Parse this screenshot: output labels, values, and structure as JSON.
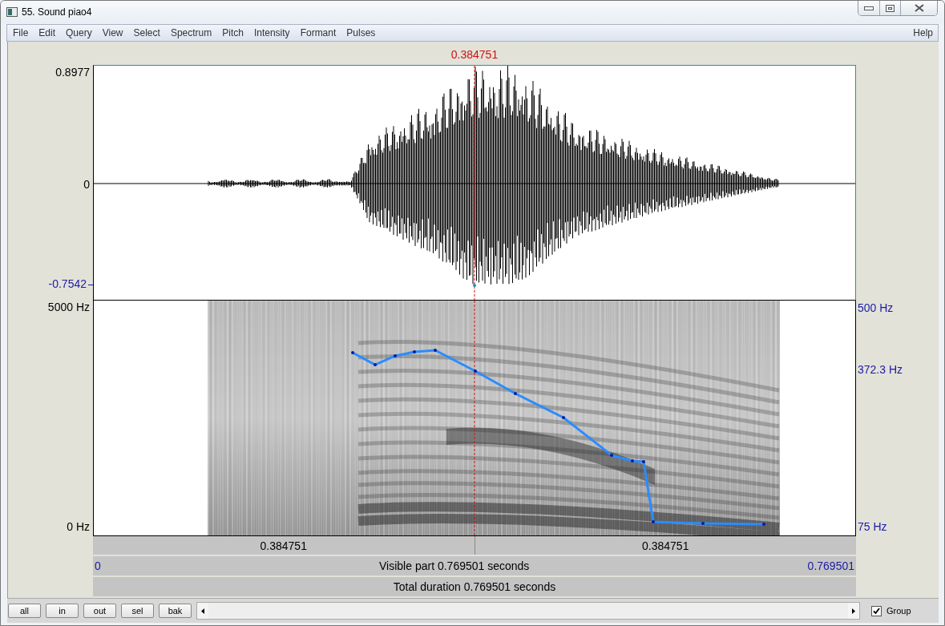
{
  "window": {
    "title": "55. Sound piao4"
  },
  "menu": {
    "items": [
      "File",
      "Edit",
      "Query",
      "View",
      "Select",
      "Spectrum",
      "Pitch",
      "Intensity",
      "Formant",
      "Pulses"
    ],
    "help": "Help"
  },
  "cursor": {
    "time": "0.384751"
  },
  "waveform": {
    "max_label": "0.8977",
    "zero_label": "0",
    "min_label": "-0.7542"
  },
  "spectrogram": {
    "freq_max": "5000 Hz",
    "freq_min": "0 Hz",
    "pitch_max": "500 Hz",
    "pitch_cursor": "372.3 Hz",
    "pitch_min": "75 Hz"
  },
  "time_bars": {
    "left_part": "0.384751",
    "right_part": "0.384751",
    "start": "0",
    "visible": "Visible part 0.769501 seconds",
    "end": "0.769501",
    "total": "Total duration 0.769501 seconds"
  },
  "buttons": [
    "all",
    "in",
    "out",
    "sel",
    "bak"
  ],
  "group": {
    "label": "Group",
    "checked": true
  }
}
